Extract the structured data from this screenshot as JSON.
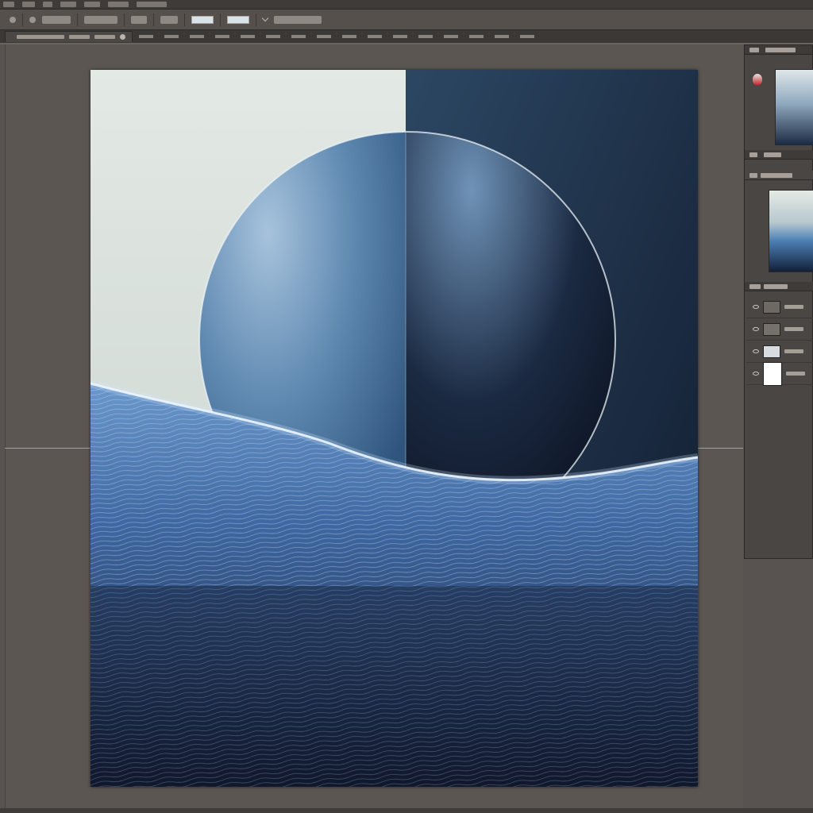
{
  "window": {
    "menu_items": [
      "",
      "",
      "",
      "",
      "",
      ""
    ]
  },
  "options_bar": {
    "field_values": [
      "",
      ""
    ]
  },
  "document": {
    "tab_title": ""
  },
  "panels": {
    "navigator_title": "",
    "layers_title": "",
    "layers": [
      {
        "name": ""
      },
      {
        "name": ""
      },
      {
        "name": ""
      },
      {
        "name": ""
      }
    ]
  },
  "colors": {
    "workspace": "#5b5652",
    "sky_light": "#d9e1dc",
    "sky_dark": "#1e3047",
    "sphere_light": "#6f98bf",
    "sphere_dark": "#10192a",
    "water_top": "#4d7ab4",
    "water_bottom": "#141d33",
    "glow": "#f4f8fb"
  },
  "icons": [
    "eye-icon",
    "close-icon",
    "brush-icon",
    "chevron-down-icon"
  ]
}
